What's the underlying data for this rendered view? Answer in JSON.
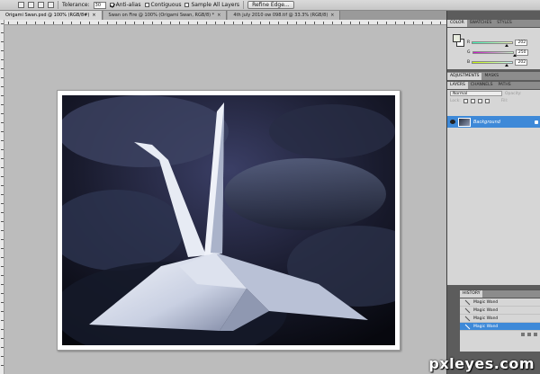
{
  "options": {
    "tolerance_label": "Tolerance:",
    "tolerance_value": "30",
    "anti_alias": "Anti-alias",
    "contiguous": "Contiguous",
    "sample_all_layers": "Sample All Layers",
    "refine_edge": "Refine Edge..."
  },
  "doc_tabs": [
    "Origami Swan.psd @ 100% (RGB/8#)",
    "Swan on Fire @ 100% (Origami Swan, RGB/8) *",
    "4th july 2010 ow 098.tif @ 33.3% (RGB/8)"
  ],
  "color_panel": {
    "tabs": [
      "COLOR",
      "SWATCHES",
      "STYLES"
    ],
    "r_label": "R",
    "r_value": "202",
    "g_label": "G",
    "g_value": "250",
    "b_label": "B",
    "b_value": "202",
    "colors": {
      "foreground": "#e8ecdf",
      "background": "#ffffff"
    }
  },
  "adjustments_tabs": [
    "ADJUSTMENTS",
    "MASKS"
  ],
  "layers_panel": {
    "tabs": [
      "LAYERS",
      "CHANNELS",
      "PATHS"
    ],
    "blend_mode": "Normal",
    "opacity_label": "Opacity:",
    "lock_label": "Lock:",
    "fill_label": "Fill:",
    "layer_name": "Background"
  },
  "history_panel": {
    "title": "HISTORY",
    "items": [
      "Magic Wand",
      "Magic Wand",
      "Magic Wand",
      "Magic Wand"
    ]
  },
  "watermark": "pxleyes.com",
  "accent_color": "#3e89d8"
}
